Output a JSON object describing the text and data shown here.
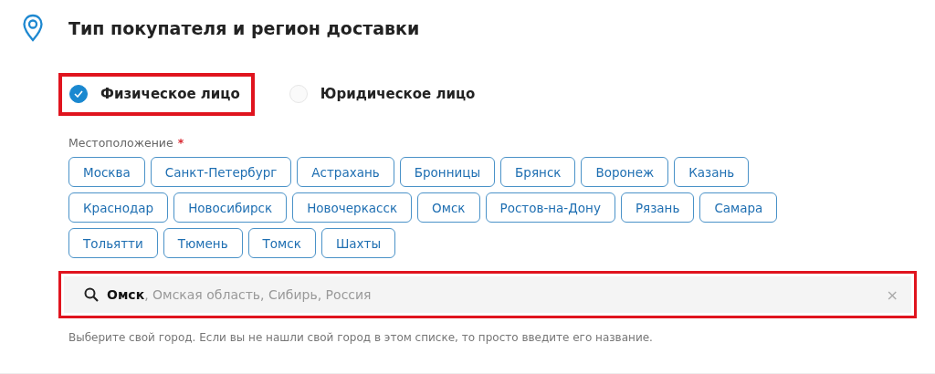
{
  "section": {
    "title": "Тип покупателя и регион доставки"
  },
  "buyer_types": [
    {
      "label": "Физическое лицо",
      "selected": true,
      "highlighted": true
    },
    {
      "label": "Юридическое лицо",
      "selected": false,
      "highlighted": false
    }
  ],
  "location": {
    "label": "Местоположение",
    "required_mark": "*",
    "city_rows": [
      [
        "Москва",
        "Санкт-Петербург",
        "Астрахань",
        "Бронницы",
        "Брянск",
        "Воронеж",
        "Казань"
      ],
      [
        "Краснодар",
        "Новосибирск",
        "Новочеркасск",
        "Омск",
        "Ростов-на-Дону",
        "Рязань",
        "Самара"
      ],
      [
        "Тольятти",
        "Тюмень",
        "Томск",
        "Шахты"
      ]
    ],
    "search": {
      "value": "**Омск**, Омская область, Сибирь, Россия",
      "clear": "×",
      "highlighted": true
    },
    "hint": "Выберите свой город. Если вы не нашли свой город в этом списке, то просто введите его название."
  }
}
